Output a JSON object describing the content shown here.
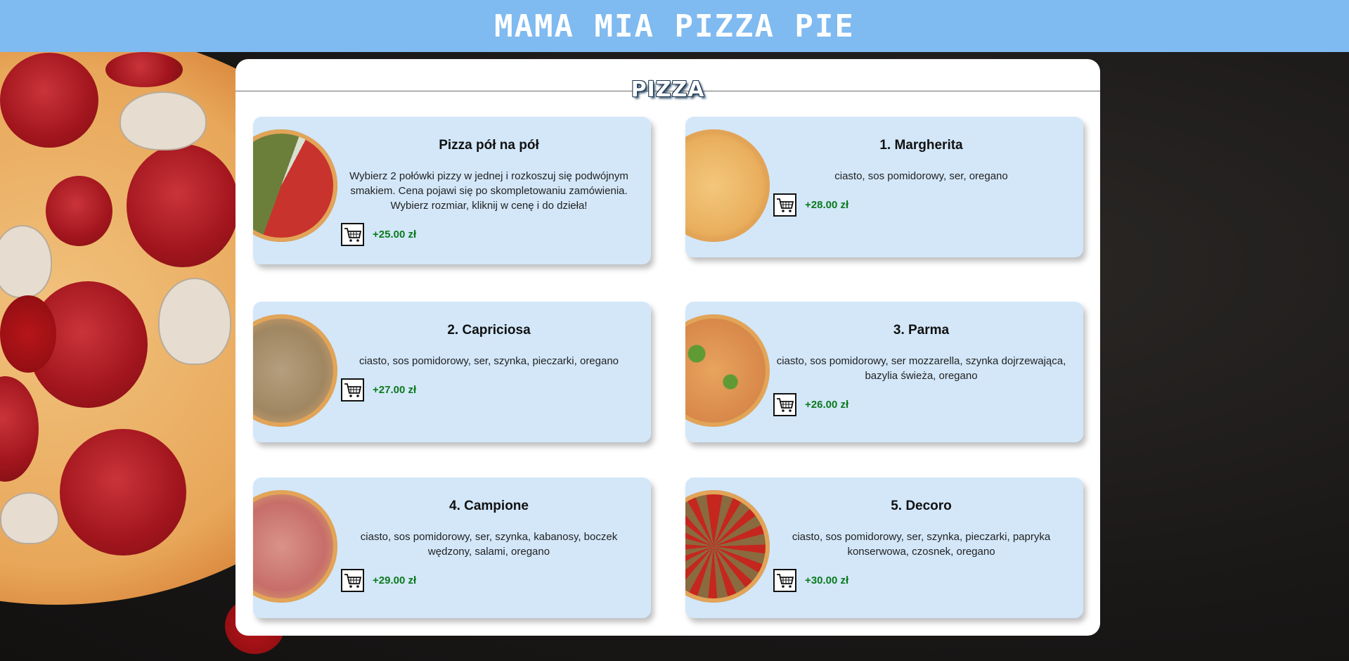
{
  "header": {
    "title": "MAMA MIA PIZZA PIE"
  },
  "section": {
    "title": "PIZZA"
  },
  "colors": {
    "header_bg": "#7fbaf0",
    "card_bg": "#d3e7f9",
    "price": "#0b7a1c"
  },
  "cards": [
    {
      "title": "Pizza pół na pół",
      "desc": "Wybierz 2 połówki pizzy w jednej i rozkoszuj się podwójnym smakiem. Cena pojawi się po skompletowaniu zamówienia. Wybierz rozmiar, kliknij w cenę i do dzieła!",
      "price": "+25.00 zł",
      "icon": "cart-icon"
    },
    {
      "title": "1. Margherita",
      "desc": "ciasto, sos pomidorowy, ser, oregano",
      "price": "+28.00 zł",
      "icon": "cart-icon"
    },
    {
      "title": "2. Capriciosa",
      "desc": "ciasto, sos pomidorowy, ser, szynka, pieczarki, oregano",
      "price": "+27.00 zł",
      "icon": "cart-icon"
    },
    {
      "title": "3. Parma",
      "desc": "ciasto, sos pomidorowy, ser mozzarella, szynka dojrzewająca, bazylia świeża, oregano",
      "price": "+26.00 zł",
      "icon": "cart-icon"
    },
    {
      "title": "4. Campione",
      "desc": "ciasto, sos pomidorowy, ser, szynka, kabanosy, boczek wędzony, salami, oregano",
      "price": "+29.00 zł",
      "icon": "cart-icon"
    },
    {
      "title": "5. Decoro",
      "desc": "ciasto, sos pomidorowy, ser, szynka, pieczarki, papryka konserwowa, czosnek, oregano",
      "price": "+30.00 zł",
      "icon": "cart-icon"
    }
  ]
}
